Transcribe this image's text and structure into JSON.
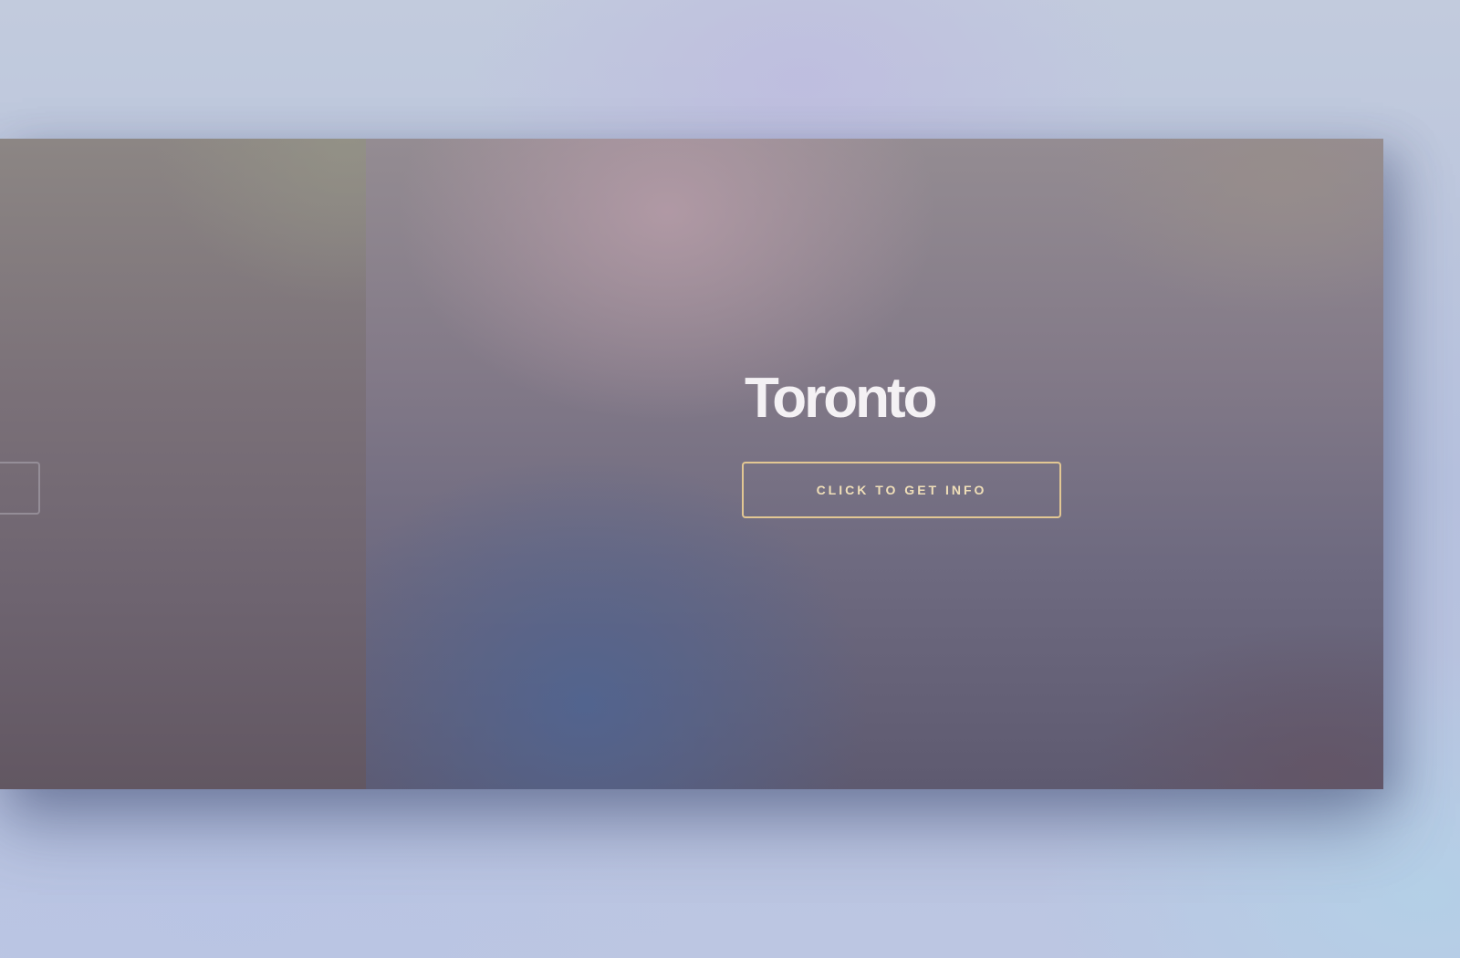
{
  "slides": {
    "active": {
      "title": "Toronto",
      "button_label": "CLICK TO GET INFO"
    }
  },
  "colors": {
    "button_border": "#e2c793",
    "button_text": "#f0dfb8",
    "title_text": "#f4f1f4"
  }
}
